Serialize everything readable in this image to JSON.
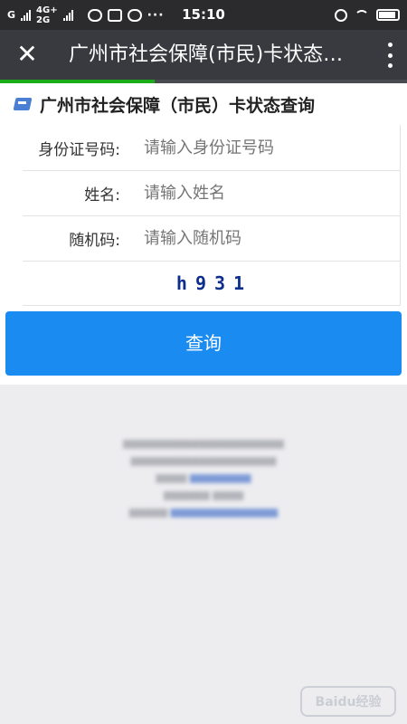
{
  "statusbar": {
    "carrier1": "G",
    "net_top": "4G+",
    "net_bottom": "2G",
    "more": "···",
    "time": "15:10"
  },
  "appbar": {
    "close_glyph": "✕",
    "title": "广州市社会保障(市民)卡状态查询"
  },
  "page": {
    "progress": 0.38,
    "heading": "广州市社会保障（市民）卡状态查询",
    "form": {
      "id_label": "身份证号码:",
      "id_placeholder": "请输入身份证号码",
      "name_label": "姓名:",
      "name_placeholder": "请输入姓名",
      "code_label": "随机码:",
      "code_placeholder": "请输入随机码",
      "captcha": "h931"
    },
    "submit_label": "查询"
  },
  "watermark": "Baidu经验",
  "colors": {
    "accent": "#1a8bf0",
    "appbar": "#393a3f",
    "statusbar": "#2b2b2d",
    "progress": "#1aad19"
  }
}
